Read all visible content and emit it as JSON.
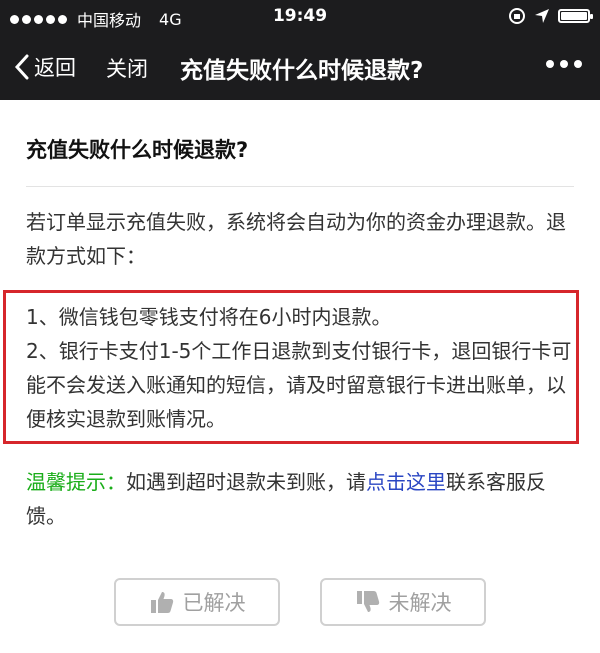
{
  "status_bar": {
    "carrier": "中国移动",
    "network": "4G",
    "time": "19:49"
  },
  "nav": {
    "back_label": "返回",
    "close_label": "关闭",
    "title": "充值失败什么时候退款?"
  },
  "article": {
    "title": "充值失败什么时候退款?",
    "intro": "若订单显示充值失败，系统将会自动为你的资金办理退款。退款方式如下：",
    "items": [
      "1、微信钱包零钱支付将在6小时内退款。",
      "2、银行卡支付1-5个工作日退款到支付银行卡，退回银行卡可能不会发送入账通知的短信，请及时留意银行卡进出账单，以便核实退款到账情况。"
    ],
    "tip_label": "温馨提示：",
    "tip_text_before": "如遇到超时退款未到账，请",
    "tip_link": "点击这里",
    "tip_text_after": "联系客服反馈。"
  },
  "feedback": {
    "solved_label": "已解决",
    "unsolved_label": "未解决"
  },
  "colors": {
    "highlight_border": "#d6262b",
    "tip_label": "#1aad19",
    "link": "#2a46c3"
  }
}
